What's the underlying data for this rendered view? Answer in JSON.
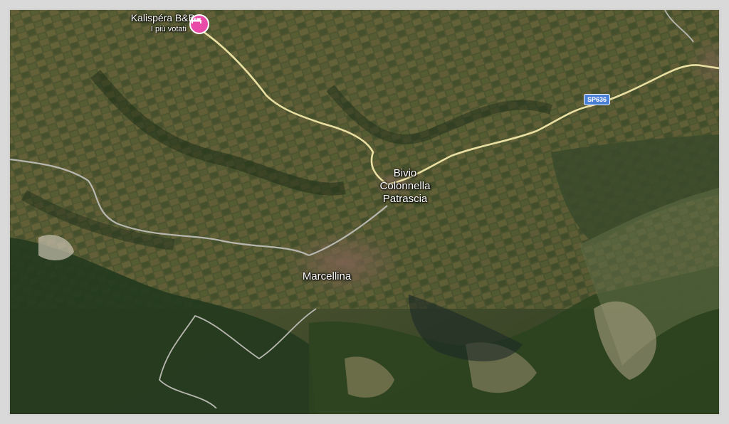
{
  "map": {
    "view": "satellite",
    "places": {
      "bivio": "Bivio",
      "colonnella": "Colonnella",
      "patrascia": "Patrascia",
      "marcellina": "Marcellina"
    },
    "poi": {
      "name": "Kalispéra B&B",
      "subtitle": "I più votati",
      "icon": "bed-icon",
      "pin_color": "#e84ba8"
    },
    "road_shield": {
      "label": "SP636",
      "color": "#4a7fd6"
    },
    "colors": {
      "road": "#e9dfa2",
      "minor_road": "#b7b7b0",
      "terrain_dark": "#233a1d",
      "terrain_field": "#8b7a45"
    }
  }
}
